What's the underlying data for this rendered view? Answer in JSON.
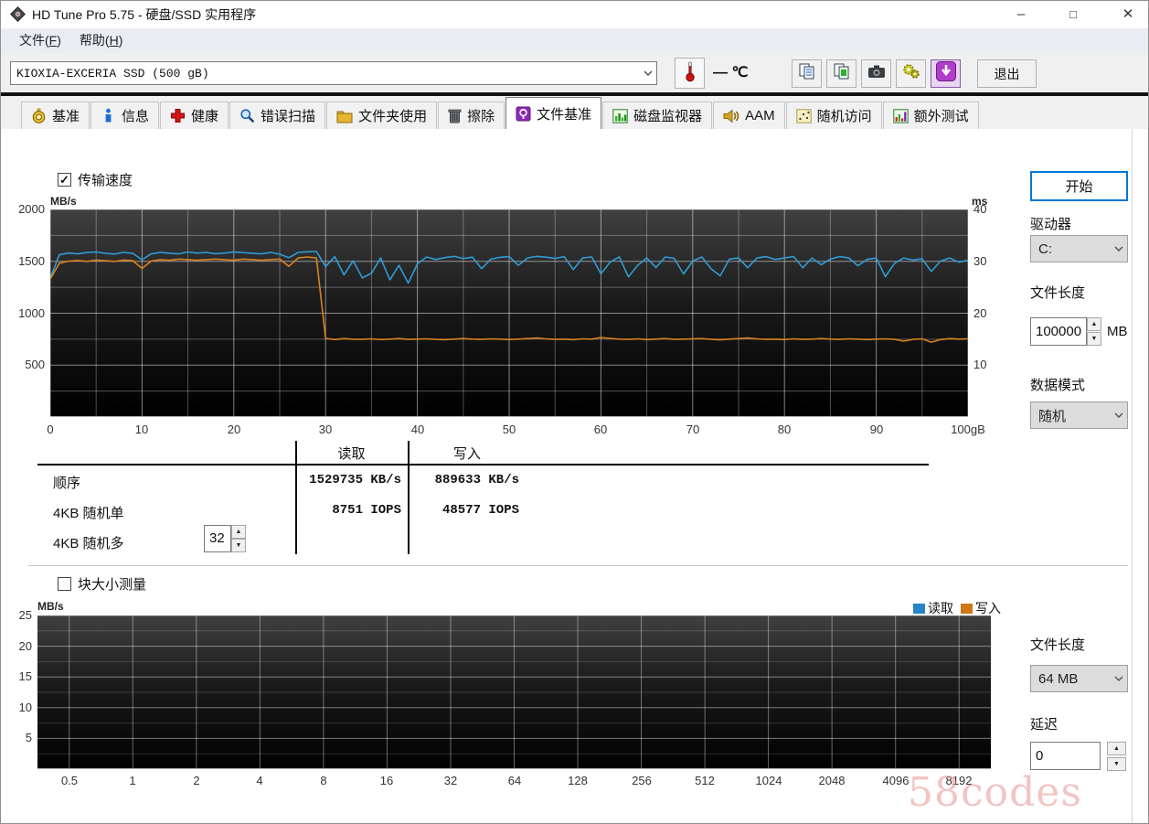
{
  "window": {
    "title": "HD Tune Pro 5.75 - 硬盘/SSD 实用程序",
    "controls": {
      "minimize": "–",
      "maximize": "□",
      "close": "✕"
    }
  },
  "menu": {
    "items": [
      {
        "pre": "文件(",
        "key": "F",
        "post": ")"
      },
      {
        "pre": "帮助(",
        "key": "H",
        "post": ")"
      }
    ]
  },
  "toolbar": {
    "drive_select": "KIOXIA-EXCERIA SSD (500 gB)",
    "temperature": "— ℃",
    "buttons": [
      {
        "icon": "copy-text-icon"
      },
      {
        "icon": "copy-image-icon"
      },
      {
        "icon": "screenshot-icon"
      },
      {
        "icon": "options-icon"
      },
      {
        "icon": "save-results-icon",
        "active": true
      }
    ],
    "exit_label": "退出"
  },
  "tabs": [
    {
      "label": "基准",
      "icon": "benchmark-icon",
      "active": false
    },
    {
      "label": "信息",
      "icon": "info-icon",
      "active": false
    },
    {
      "label": "健康",
      "icon": "health-icon",
      "active": false
    },
    {
      "label": "错误扫描",
      "icon": "error-scan-icon",
      "active": false
    },
    {
      "label": "文件夹使用",
      "icon": "folder-usage-icon",
      "active": false
    },
    {
      "label": "擦除",
      "icon": "erase-icon",
      "active": false
    },
    {
      "label": "文件基准",
      "icon": "file-benchmark-icon",
      "active": true
    },
    {
      "label": "磁盘监视器",
      "icon": "disk-monitor-icon",
      "active": false
    },
    {
      "label": "AAM",
      "icon": "aam-icon",
      "active": false
    },
    {
      "label": "随机访问",
      "icon": "random-access-icon",
      "active": false
    },
    {
      "label": "额外测试",
      "icon": "extra-tests-icon",
      "active": false
    }
  ],
  "file_benchmark": {
    "transfer_speed_label": "传输速度",
    "transfer_speed_checked": true,
    "start_button": "开始",
    "drive_label": "驱动器",
    "drive_value": "C:",
    "file_length_label": "文件长度",
    "file_length_value": "100000",
    "file_length_unit": "MB",
    "data_mode_label": "数据模式",
    "data_mode_value": "随机",
    "results": {
      "read_header": "读取",
      "write_header": "写入",
      "rows": [
        {
          "label": "顺序",
          "read": "1529735 KB/s",
          "write": "889633 KB/s"
        },
        {
          "label": "4KB 随机单",
          "read": "8751 IOPS",
          "write": "48577 IOPS"
        },
        {
          "label": "4KB 随机多",
          "queue_depth": "32"
        }
      ]
    }
  },
  "block_size_test": {
    "checkbox_label": "块大小测量",
    "checked": false,
    "file_length_label": "文件长度",
    "file_length_value": "64 MB",
    "delay_label": "延迟",
    "delay_value": "0"
  },
  "watermark": "58codes",
  "chart_data": [
    {
      "name": "transfer-speed-chart",
      "type": "line",
      "ylabel_left": "MB/s",
      "ylabel_right": "ms",
      "xlim": [
        0,
        100
      ],
      "ylim_left": [
        0,
        2000
      ],
      "ylim_right": [
        0,
        40
      ],
      "x_ticks": [
        0,
        10,
        20,
        30,
        40,
        50,
        60,
        70,
        80,
        90
      ],
      "x_last_label": "100gB",
      "y_ticks_left": [
        2000,
        1500,
        1000,
        500
      ],
      "y_ticks_right": [
        40,
        30,
        20,
        10
      ],
      "grid": {
        "x_minor_step": 5,
        "x_major_step": 10,
        "y_minor_step": 250,
        "y_major_step": 500
      },
      "series": [
        {
          "name": "读取",
          "color": "#2f9cd4",
          "x_step": 1,
          "values": [
            1340,
            1565,
            1580,
            1572,
            1585,
            1590,
            1578,
            1570,
            1586,
            1576,
            1515,
            1572,
            1586,
            1578,
            1572,
            1590,
            1580,
            1586,
            1574,
            1580,
            1590,
            1584,
            1578,
            1572,
            1586,
            1568,
            1535,
            1586,
            1592,
            1595,
            1450,
            1545,
            1370,
            1505,
            1340,
            1385,
            1532,
            1322,
            1462,
            1290,
            1475,
            1542,
            1518,
            1536,
            1548,
            1528,
            1540,
            1430,
            1522,
            1538,
            1545,
            1462,
            1532,
            1548,
            1540,
            1528,
            1545,
            1420,
            1532,
            1542,
            1380,
            1492,
            1542,
            1350,
            1462,
            1532,
            1440,
            1542,
            1528,
            1378,
            1502,
            1542,
            1428,
            1360,
            1522,
            1532,
            1438,
            1532,
            1545,
            1518,
            1532,
            1545,
            1438,
            1532,
            1468,
            1522,
            1545,
            1532,
            1458,
            1518,
            1532,
            1352,
            1482,
            1532,
            1512,
            1525,
            1402,
            1502,
            1532,
            1492,
            1512
          ]
        },
        {
          "name": "写入",
          "color": "#d8821f",
          "x_step": 1,
          "values": [
            1330,
            1482,
            1502,
            1508,
            1500,
            1512,
            1506,
            1500,
            1512,
            1506,
            1432,
            1502,
            1516,
            1510,
            1522,
            1516,
            1510,
            1516,
            1522,
            1516,
            1510,
            1522,
            1516,
            1510,
            1516,
            1522,
            1452,
            1532,
            1542,
            1532,
            758,
            746,
            756,
            750,
            748,
            753,
            746,
            751,
            756,
            748,
            751,
            753,
            748,
            745,
            751,
            756,
            751,
            748,
            753,
            751,
            746,
            751,
            756,
            761,
            753,
            748,
            751,
            745,
            753,
            751,
            766,
            758,
            751,
            748,
            753,
            746,
            751,
            756,
            748,
            751,
            753,
            756,
            748,
            744,
            751,
            756,
            761,
            753,
            748,
            751,
            746,
            753,
            748,
            751,
            756,
            751,
            748,
            753,
            751,
            746,
            751,
            753,
            748,
            731,
            748,
            753,
            722,
            746,
            756,
            751,
            753
          ]
        }
      ]
    },
    {
      "name": "block-size-chart",
      "type": "line",
      "ylabel_left": "MB/s",
      "ylim_left": [
        0,
        25
      ],
      "y_ticks_left": [
        25,
        20,
        15,
        10,
        5
      ],
      "x_tick_labels": [
        "0.5",
        "1",
        "2",
        "4",
        "8",
        "16",
        "32",
        "64",
        "128",
        "256",
        "512",
        "1024",
        "2048",
        "4096",
        "8192"
      ],
      "grid": {
        "y_minor_step": 2.5,
        "y_major_step": 5
      },
      "series": [],
      "legend": [
        {
          "label": "读取",
          "color": "#2585c7"
        },
        {
          "label": "写入",
          "color": "#d07818"
        }
      ]
    }
  ]
}
